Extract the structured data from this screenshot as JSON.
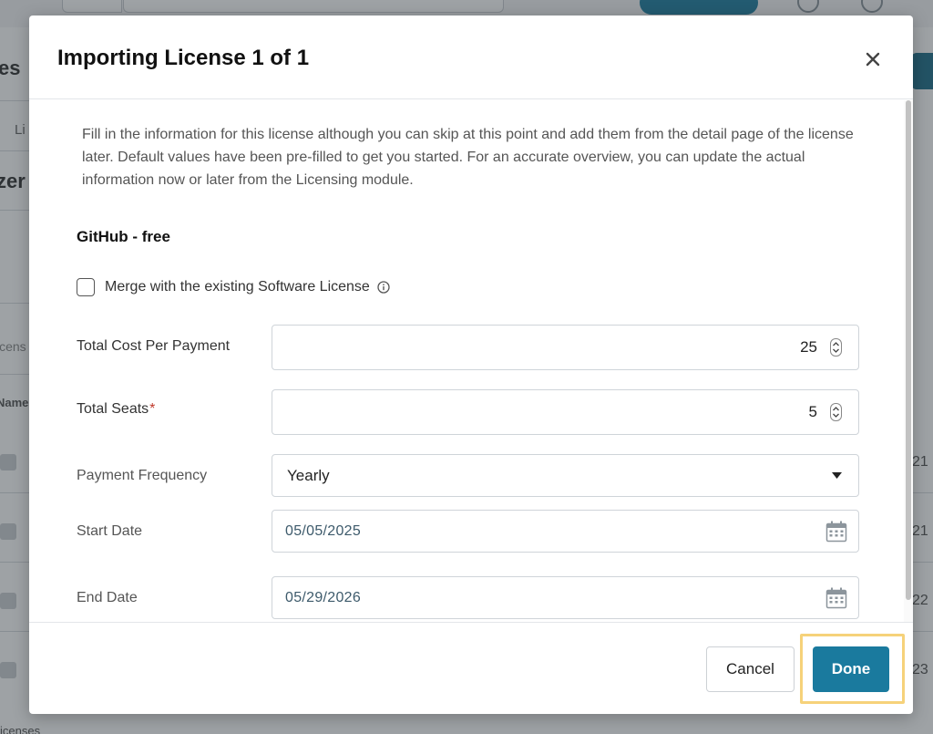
{
  "modal": {
    "title": "Importing License 1 of 1",
    "close_label": "×",
    "intro": "Fill in the information for this license although you can skip at this point and add them from the detail page of the license later. Default values have been pre-filled to get you started. For an accurate overview, you can update the actual information now or later from the Licensing module.",
    "product_name": "GitHub - free",
    "merge": {
      "label": "Merge with the existing Software License",
      "checked": false
    },
    "fields": {
      "total_cost_label": "Total Cost Per Payment",
      "total_cost_value": "25",
      "total_seats_label": "Total Seats",
      "total_seats_required": "*",
      "total_seats_value": "5",
      "payment_frequency_label": "Payment Frequency",
      "payment_frequency_value": "Yearly",
      "start_date_label": "Start Date",
      "start_date_value": "05/05/2025",
      "end_date_label": "End Date",
      "end_date_value": "05/29/2026"
    },
    "footer": {
      "cancel_label": "Cancel",
      "done_label": "Done"
    }
  },
  "background": {
    "heading_fragment_1": "es",
    "heading_fragment_2": "zer",
    "tab_fragment": "Li",
    "search_fragment": "icens",
    "column_fragment": "Name",
    "row_values": [
      "21",
      "21",
      "22",
      "23"
    ],
    "footer_fragment": "icenses"
  },
  "colors": {
    "primary": "#1a7a9e",
    "focus_ring": "#f6d27a",
    "required": "#c0392b"
  }
}
